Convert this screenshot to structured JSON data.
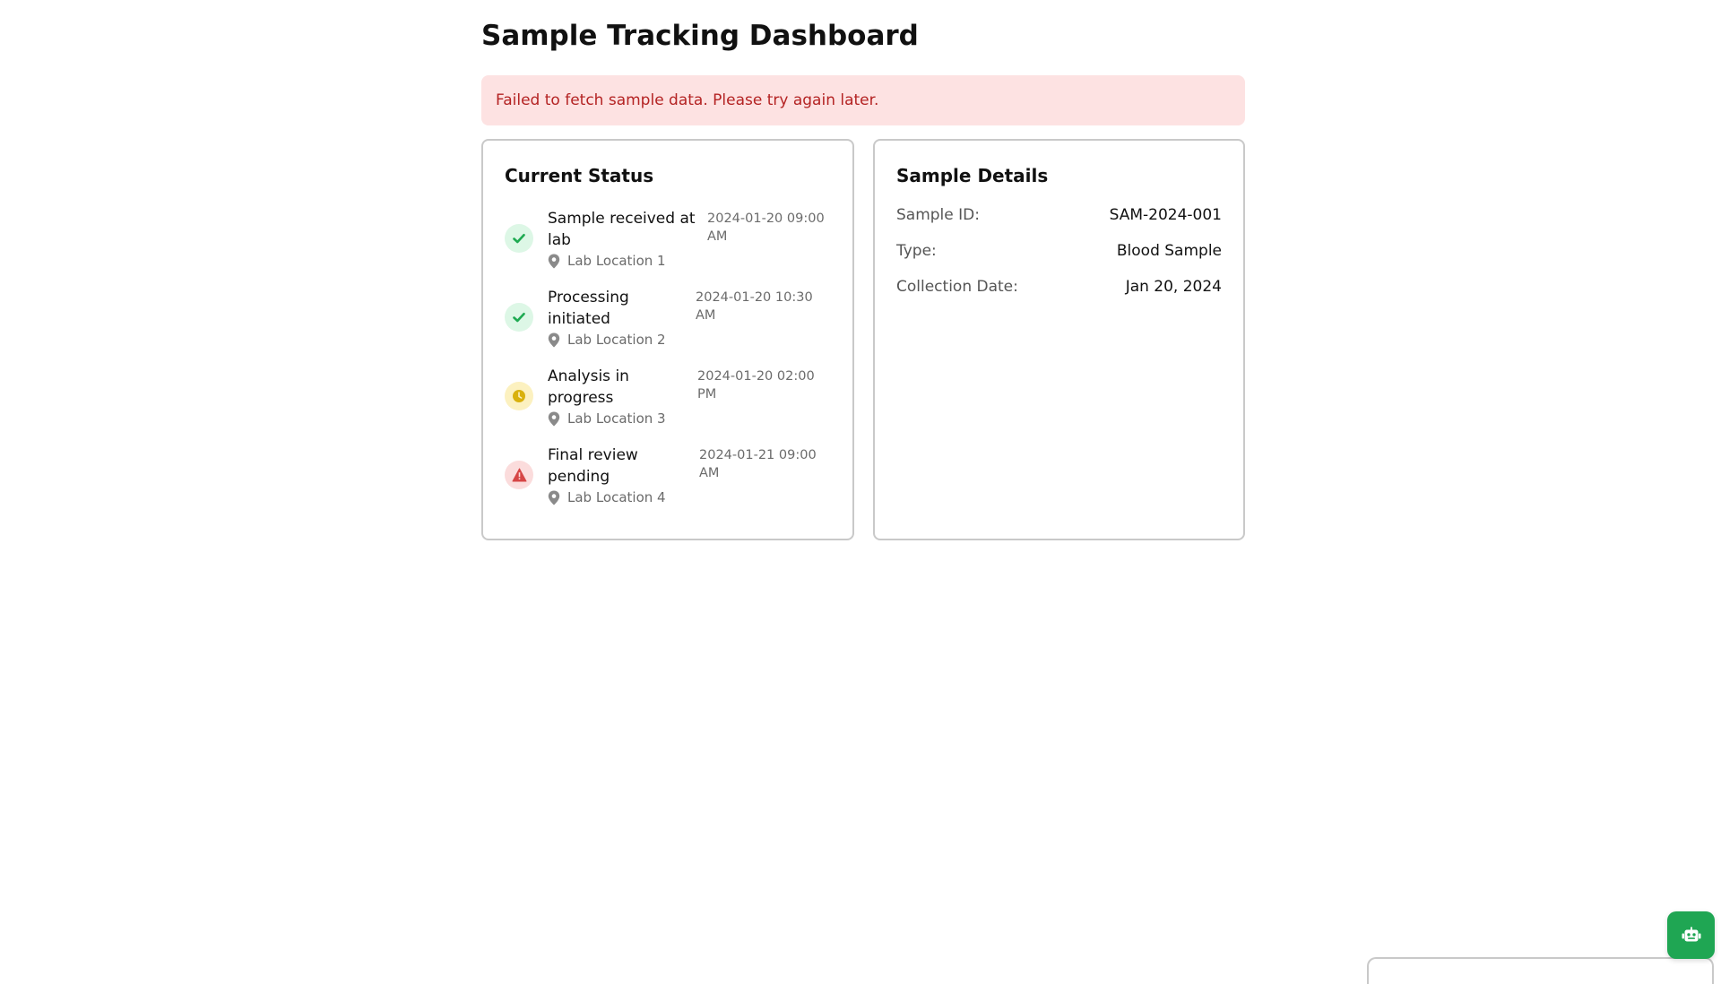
{
  "page": {
    "title": "Sample Tracking Dashboard"
  },
  "error": {
    "message": "Failed to fetch sample data. Please try again later."
  },
  "status_card": {
    "title": "Current Status",
    "items": [
      {
        "title": "Sample received at lab",
        "time": "2024-01-20 09:00 AM",
        "location": "Lab Location 1",
        "state": "completed",
        "icon": "check-icon",
        "color": "#1faa52"
      },
      {
        "title": "Processing initiated",
        "time": "2024-01-20 10:30 AM",
        "location": "Lab Location 2",
        "state": "completed",
        "icon": "check-icon",
        "color": "#1faa52"
      },
      {
        "title": "Analysis in progress",
        "time": "2024-01-20 02:00 PM",
        "location": "Lab Location 3",
        "state": "in-progress",
        "icon": "clock-icon",
        "color": "#d9b10c"
      },
      {
        "title": "Final review pending",
        "time": "2024-01-21 09:00 AM",
        "location": "Lab Location 4",
        "state": "warning",
        "icon": "alert-triangle-icon",
        "color": "#d64545"
      }
    ]
  },
  "details_card": {
    "title": "Sample Details",
    "rows": [
      {
        "label": "Sample ID:",
        "value": "SAM-2024-001"
      },
      {
        "label": "Type:",
        "value": "Blood Sample"
      },
      {
        "label": "Collection Date:",
        "value": "Jan 20, 2024"
      }
    ]
  },
  "fab": {
    "icon": "robot-icon",
    "color": "#1fa653"
  }
}
